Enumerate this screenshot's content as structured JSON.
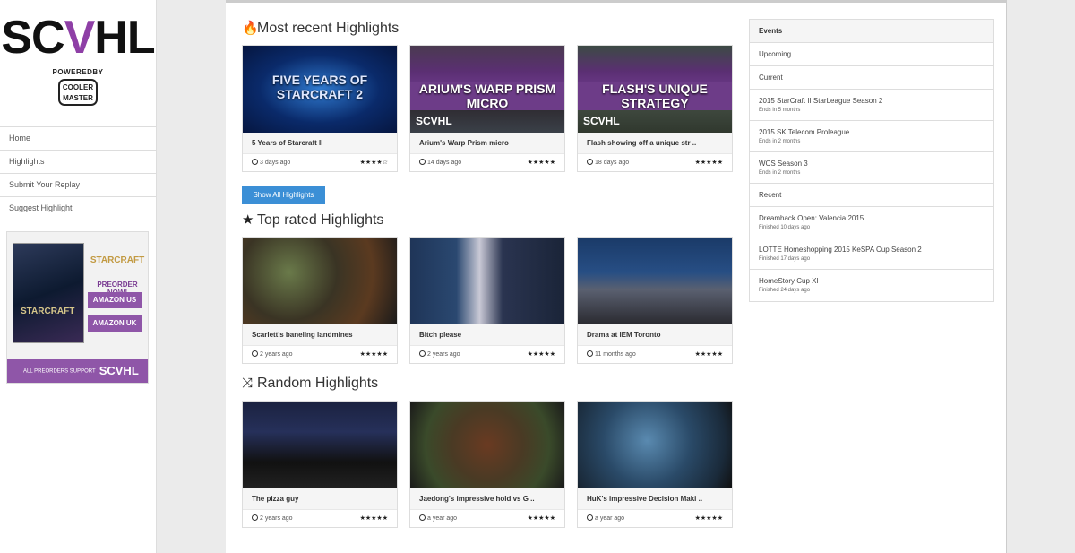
{
  "sidebar": {
    "logo": "SCVHL",
    "powered_by": "POWEREDBY",
    "sponsor": "COOLER MASTER",
    "nav": [
      "Home",
      "Highlights",
      "Submit Your Replay",
      "Suggest Highlight"
    ],
    "ad": {
      "game": "STARCRAFT",
      "preorder": "PREORDER NOW!",
      "btn_us": "AMAZON US",
      "btn_uk": "AMAZON UK",
      "footer": "ALL PREORDERS SUPPORT",
      "footer_brand": "SCVHL"
    }
  },
  "sections": [
    {
      "title": "Most recent Highlights",
      "icon": "fire-icon",
      "cards": [
        {
          "title": "5 Years of Starcraft II",
          "age": "3 days ago",
          "stars": "★★★★☆",
          "caption": "FIVE YEARS OF STARCRAFT 2",
          "logo": ""
        },
        {
          "title": "Arium's Warp Prism micro",
          "age": "14 days ago",
          "stars": "★★★★★",
          "caption": "ARIUM'S WARP PRISM MICRO",
          "logo": "SCVHL"
        },
        {
          "title": "Flash showing off a unique str ..",
          "age": "18 days ago",
          "stars": "★★★★★",
          "caption": "FLASH'S UNIQUE STRATEGY",
          "logo": "SCVHL"
        }
      ]
    },
    {
      "title": "Top rated Highlights",
      "icon": "star-icon",
      "cards": [
        {
          "title": "Scarlett's baneling landmines",
          "age": "2 years ago",
          "stars": "★★★★★",
          "caption": "",
          "logo": ""
        },
        {
          "title": "Bitch please",
          "age": "2 years ago",
          "stars": "★★★★★",
          "caption": "",
          "logo": ""
        },
        {
          "title": "Drama at IEM Toronto",
          "age": "11 months ago",
          "stars": "★★★★★",
          "caption": "",
          "logo": ""
        }
      ]
    },
    {
      "title": "Random Highlights",
      "icon": "shuffle-icon",
      "cards": [
        {
          "title": "The pizza guy",
          "age": "2 years ago",
          "stars": "★★★★★",
          "caption": "",
          "logo": ""
        },
        {
          "title": "Jaedong's impressive hold vs G ..",
          "age": "a year ago",
          "stars": "★★★★★",
          "caption": "",
          "logo": ""
        },
        {
          "title": "HuK's impressive Decision Maki ..",
          "age": "a year ago",
          "stars": "★★★★★",
          "caption": "",
          "logo": ""
        }
      ]
    }
  ],
  "show_all_label": "Show All Highlights",
  "events": {
    "header": "Events",
    "upcoming_label": "Upcoming",
    "current_label": "Current",
    "current": [
      {
        "name": "2015 StarCraft II StarLeague Season 2",
        "time": "Ends in 5 months"
      },
      {
        "name": "2015 SK Telecom Proleague",
        "time": "Ends in 2 months"
      },
      {
        "name": "WCS Season 3",
        "time": "Ends in 2 months"
      }
    ],
    "recent_label": "Recent",
    "recent": [
      {
        "name": "Dreamhack Open: Valencia 2015",
        "time": "Finished 10 days ago"
      },
      {
        "name": "LOTTE Homeshopping 2015 KeSPA Cup Season 2",
        "time": "Finished 17 days ago"
      },
      {
        "name": "HomeStory Cup XI",
        "time": "Finished 24 days ago"
      }
    ]
  },
  "colors": {
    "accent": "#8f56a8",
    "button": "#3b8fd6"
  }
}
